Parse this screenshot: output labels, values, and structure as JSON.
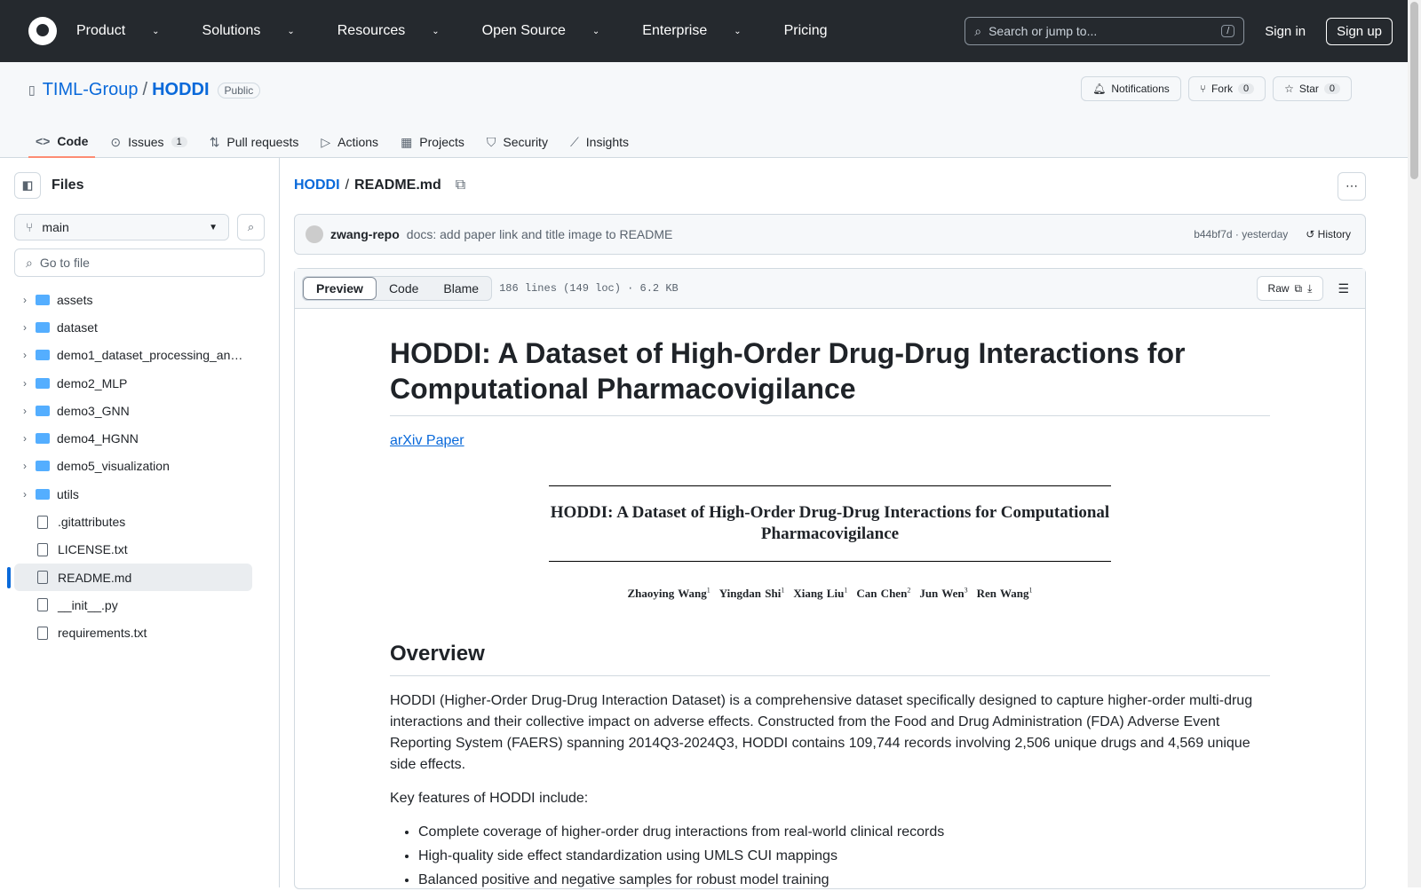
{
  "header": {
    "nav": [
      "Product",
      "Solutions",
      "Resources",
      "Open Source",
      "Enterprise",
      "Pricing"
    ],
    "search_placeholder": "Search or jump to...",
    "search_key": "/",
    "sign_in": "Sign in",
    "sign_up": "Sign up"
  },
  "repo": {
    "owner": "TIML-Group",
    "name": "HODDI",
    "visibility": "Public",
    "notifications": "Notifications",
    "fork": "Fork",
    "fork_count": "0",
    "star": "Star",
    "star_count": "0"
  },
  "tabs": [
    {
      "label": "Code",
      "icon": "code-icon"
    },
    {
      "label": "Issues",
      "count": "1",
      "icon": "issue-icon"
    },
    {
      "label": "Pull requests",
      "icon": "pr-icon"
    },
    {
      "label": "Actions",
      "icon": "play-icon"
    },
    {
      "label": "Projects",
      "icon": "table-icon"
    },
    {
      "label": "Security",
      "icon": "shield-icon"
    },
    {
      "label": "Insights",
      "icon": "graph-icon"
    }
  ],
  "sidebar": {
    "title": "Files",
    "branch": "main",
    "goto_placeholder": "Go to file",
    "items": [
      {
        "name": "assets",
        "type": "dir"
      },
      {
        "name": "dataset",
        "type": "dir"
      },
      {
        "name": "demo1_dataset_processing_an…",
        "type": "dir"
      },
      {
        "name": "demo2_MLP",
        "type": "dir"
      },
      {
        "name": "demo3_GNN",
        "type": "dir"
      },
      {
        "name": "demo4_HGNN",
        "type": "dir"
      },
      {
        "name": "demo5_visualization",
        "type": "dir"
      },
      {
        "name": "utils",
        "type": "dir"
      },
      {
        "name": ".gitattributes",
        "type": "file"
      },
      {
        "name": "LICENSE.txt",
        "type": "file"
      },
      {
        "name": "README.md",
        "type": "file",
        "selected": true
      },
      {
        "name": "__init__.py",
        "type": "file"
      },
      {
        "name": "requirements.txt",
        "type": "file"
      }
    ]
  },
  "file": {
    "repo": "HODDI",
    "name": "README.md",
    "commit_author": "zwang-repo",
    "commit_msg": "docs: add paper link and title image to README",
    "commit_hash": "b44bf7d · yesterday",
    "history": "History",
    "views": [
      "Preview",
      "Code",
      "Blame"
    ],
    "meta": "186 lines (149 loc) · 6.2 KB",
    "raw": "Raw"
  },
  "readme": {
    "title": "HODDI: A Dataset of High-Order Drug-Drug Interactions for Computational Pharmacovigilance",
    "link": "arXiv Paper",
    "image_title": "HODDI: A Dataset of High-Order Drug-Drug Interactions for Computational Pharmacovigilance",
    "authors": [
      {
        "n": "Zhaoying Wang",
        "a": "1"
      },
      {
        "n": "Yingdan Shi",
        "a": "1"
      },
      {
        "n": "Xiang Liu",
        "a": "1"
      },
      {
        "n": "Can Chen",
        "a": "2"
      },
      {
        "n": "Jun Wen",
        "a": "3"
      },
      {
        "n": "Ren Wang",
        "a": "1"
      }
    ],
    "overview": "Overview",
    "p1": "HODDI (Higher-Order Drug-Drug Interaction Dataset) is a comprehensive dataset specifically designed to capture higher-order multi-drug interactions and their collective impact on adverse effects. Constructed from the Food and Drug Administration (FDA) Adverse Event Reporting System (FAERS) spanning 2014Q3-2024Q3, HODDI contains 109,744 records involving 2,506 unique drugs and 4,569 unique side effects.",
    "p2": "Key features of HODDI include:",
    "bullets": [
      "Complete coverage of higher-order drug interactions from real-world clinical records",
      "High-quality side effect standardization using UMLS CUI mappings",
      "Balanced positive and negative samples for robust model training"
    ]
  }
}
